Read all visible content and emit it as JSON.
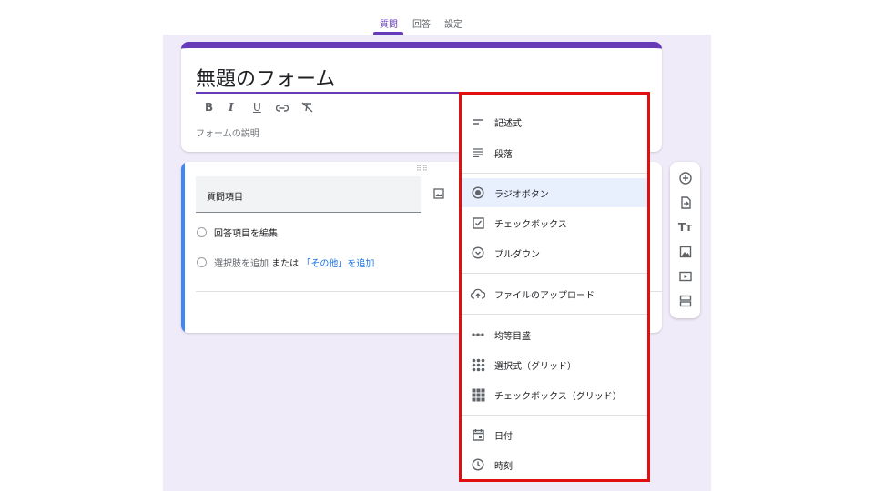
{
  "tabs": [
    {
      "label": "質問",
      "active": true
    },
    {
      "label": "回答",
      "active": false
    },
    {
      "label": "設定",
      "active": false
    }
  ],
  "accent_color": "#673ab7",
  "highlight_color": "#e01010",
  "form": {
    "title": "無題のフォーム",
    "description_placeholder": "フォームの説明",
    "format_buttons": [
      "B",
      "I",
      "U",
      "link",
      "clear-format"
    ]
  },
  "question": {
    "title": "質問項目",
    "option_edit": "回答項目を編集",
    "add_option": "選択肢を追加",
    "or_text": "または",
    "add_other": "「その他」を追加"
  },
  "side_toolbar": [
    "add-question-icon",
    "import-questions-icon",
    "add-title-icon",
    "add-image-icon",
    "add-video-icon",
    "add-section-icon"
  ],
  "question_types": [
    {
      "label": "記述式",
      "icon": "short-answer-icon"
    },
    {
      "label": "段落",
      "icon": "paragraph-icon"
    },
    {
      "label": "ラジオボタン",
      "icon": "radio-button-icon",
      "selected": true
    },
    {
      "label": "チェックボックス",
      "icon": "checkbox-icon"
    },
    {
      "label": "プルダウン",
      "icon": "dropdown-icon"
    },
    {
      "label": "ファイルのアップロード",
      "icon": "cloud-upload-icon"
    },
    {
      "label": "均等目盛",
      "icon": "linear-scale-icon"
    },
    {
      "label": "選択式（グリッド）",
      "icon": "multiple-choice-grid-icon"
    },
    {
      "label": "チェックボックス（グリッド）",
      "icon": "checkbox-grid-icon"
    },
    {
      "label": "日付",
      "icon": "calendar-icon"
    },
    {
      "label": "時刻",
      "icon": "clock-icon"
    }
  ]
}
